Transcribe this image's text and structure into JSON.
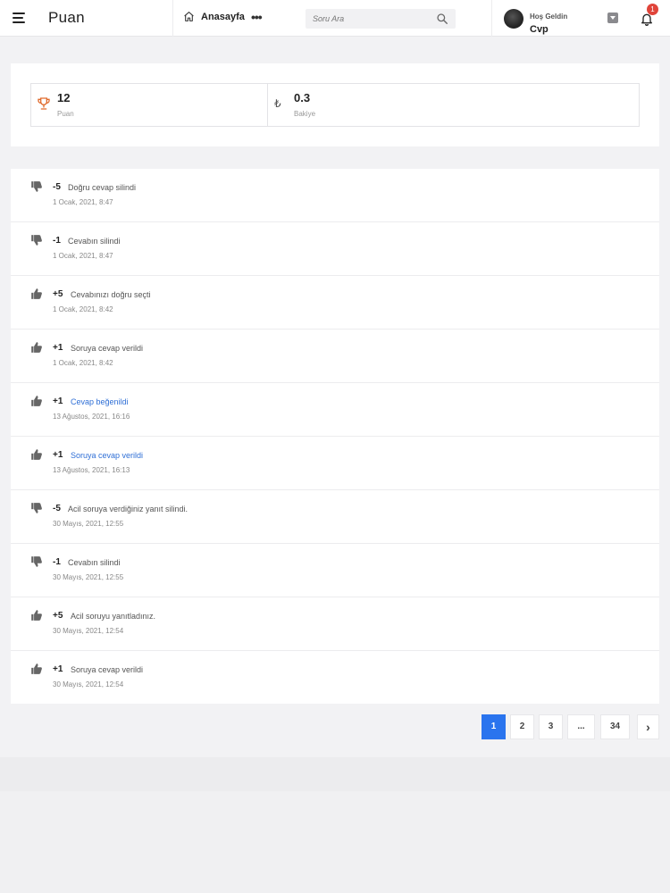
{
  "header": {
    "brand": "Puan",
    "home_label": "Anasayfa",
    "more_label": "•••",
    "search_placeholder": "Soru Ara",
    "welcome": "Hoş Geldin",
    "username": "Cvp",
    "notification_count": "1"
  },
  "stats": {
    "points_value": "12",
    "points_label": "Puan",
    "balance_icon": "₺",
    "balance_value": "0.3",
    "balance_label": "Bakiye"
  },
  "activity": [
    {
      "type": "down",
      "points": "-5",
      "desc": "Doğru cevap silindi",
      "link": false,
      "date": "1 Ocak, 2021, 8:47"
    },
    {
      "type": "down",
      "points": "-1",
      "desc": "Cevabın silindi",
      "link": false,
      "date": "1 Ocak, 2021, 8:47"
    },
    {
      "type": "up",
      "points": "+5",
      "desc": "Cevabınızı doğru seçti",
      "link": false,
      "date": "1 Ocak, 2021, 8:42"
    },
    {
      "type": "up",
      "points": "+1",
      "desc": "Soruya cevap verildi",
      "link": false,
      "date": "1 Ocak, 2021, 8:42"
    },
    {
      "type": "up",
      "points": "+1",
      "desc": "Cevap beğenildi",
      "link": true,
      "date": "13 Ağustos, 2021, 16:16"
    },
    {
      "type": "up",
      "points": "+1",
      "desc": "Soruya cevap verildi",
      "link": true,
      "date": "13 Ağustos, 2021, 16:13"
    },
    {
      "type": "down",
      "points": "-5",
      "desc": "Acil soruya verdiğiniz yanıt silindi.",
      "link": false,
      "date": "30 Mayıs, 2021, 12:55"
    },
    {
      "type": "down",
      "points": "-1",
      "desc": "Cevabın silindi",
      "link": false,
      "date": "30 Mayıs, 2021, 12:55"
    },
    {
      "type": "up",
      "points": "+5",
      "desc": "Acil soruyu yanıtladınız.",
      "link": false,
      "date": "30 Mayıs, 2021, 12:54"
    },
    {
      "type": "up",
      "points": "+1",
      "desc": "Soruya cevap verildi",
      "link": false,
      "date": "30 Mayıs, 2021, 12:54"
    }
  ],
  "pagination": {
    "pages": [
      "1",
      "2",
      "3",
      "...",
      "34"
    ],
    "next": "›",
    "current": "1"
  },
  "colors": {
    "accent": "#2a74ee",
    "link": "#2f6fd6",
    "trophy": "#e06a2c",
    "badge": "#e0443a"
  }
}
